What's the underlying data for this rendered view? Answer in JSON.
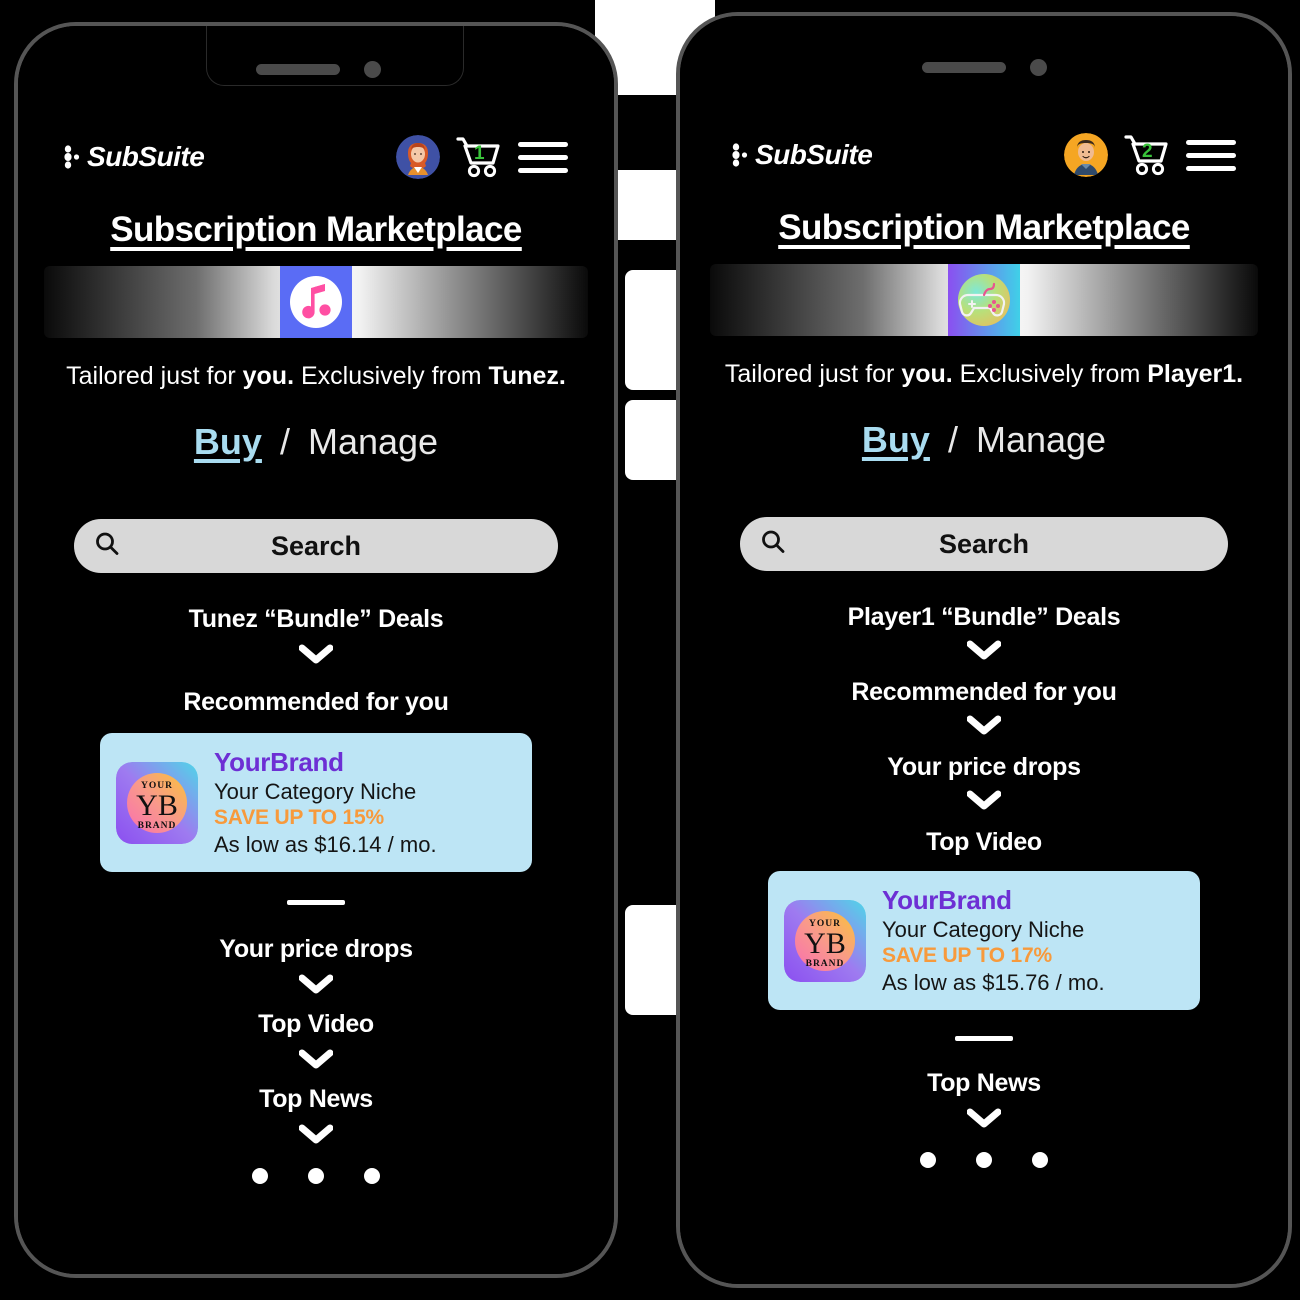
{
  "app": {
    "logo_text": "SubSuite",
    "page_title": "Subscription Marketplace"
  },
  "phones": [
    {
      "id": "left",
      "header": {
        "logo_text": "SubSuite",
        "avatar_name": "female-avatar",
        "cart_count": "1",
        "menu_label": "Menu"
      },
      "page_title": "Subscription Marketplace",
      "banner": {
        "icon_name": "music-note-icon",
        "brand": "Tunez"
      },
      "tagline": {
        "part1": "Tailored just for ",
        "emphasis1": "you.",
        "part2": " Exclusively from ",
        "emphasis2": "Tunez."
      },
      "tabs": {
        "buy": "Buy",
        "separator": "/",
        "manage": "Manage",
        "active": "Buy"
      },
      "search": {
        "label": "Search",
        "placeholder": "Search"
      },
      "sections": [
        {
          "label": "Tunez “Bundle” Deals",
          "has_card": false
        },
        {
          "label": "Recommended for you",
          "has_card": true
        },
        {
          "label": "Your price drops",
          "has_card": false
        },
        {
          "label": "Top Video",
          "has_card": false
        },
        {
          "label": "Top News",
          "has_card": false
        }
      ],
      "card": {
        "brand": "YourBrand",
        "niche": "Your Category Niche",
        "save": "SAVE UP TO 15%",
        "price": "As low as $16.14 / mo.",
        "logo_top": "YOUR",
        "logo_mid": "YB",
        "logo_bottom": "BRAND"
      },
      "dots": 3
    },
    {
      "id": "right",
      "header": {
        "logo_text": "SubSuite",
        "avatar_name": "male-avatar",
        "cart_count": "2",
        "menu_label": "Menu"
      },
      "page_title": "Subscription Marketplace",
      "banner": {
        "icon_name": "gamepad-icon",
        "brand": "Player1"
      },
      "tagline": {
        "part1": "Tailored just for ",
        "emphasis1": "you.",
        "part2": " Exclusively from ",
        "emphasis2": "Player1."
      },
      "tabs": {
        "buy": "Buy",
        "separator": "/",
        "manage": "Manage",
        "active": "Buy"
      },
      "search": {
        "label": "Search",
        "placeholder": "Search"
      },
      "sections": [
        {
          "label": "Player1 “Bundle” Deals",
          "has_card": false
        },
        {
          "label": "Recommended for you",
          "has_card": false
        },
        {
          "label": "Your price drops",
          "has_card": false
        },
        {
          "label": "Top Video",
          "has_card": true
        },
        {
          "label": "Top News",
          "has_card": false
        }
      ],
      "card": {
        "brand": "YourBrand",
        "niche": "Your Category Niche",
        "save": "SAVE UP TO 17%",
        "price": "As low as $15.76 / mo.",
        "logo_top": "YOUR",
        "logo_mid": "YB",
        "logo_bottom": "BRAND"
      },
      "dots": 3
    }
  ],
  "colors": {
    "background": "#000000",
    "frame": "#555555",
    "tab_active": "#a9dcf0",
    "card_bg": "#bde5f5",
    "card_brand": "#6d2fd4",
    "card_save": "#f79a3c",
    "cart_badge": "#39c23a",
    "search_bg": "#d8d8d8"
  }
}
